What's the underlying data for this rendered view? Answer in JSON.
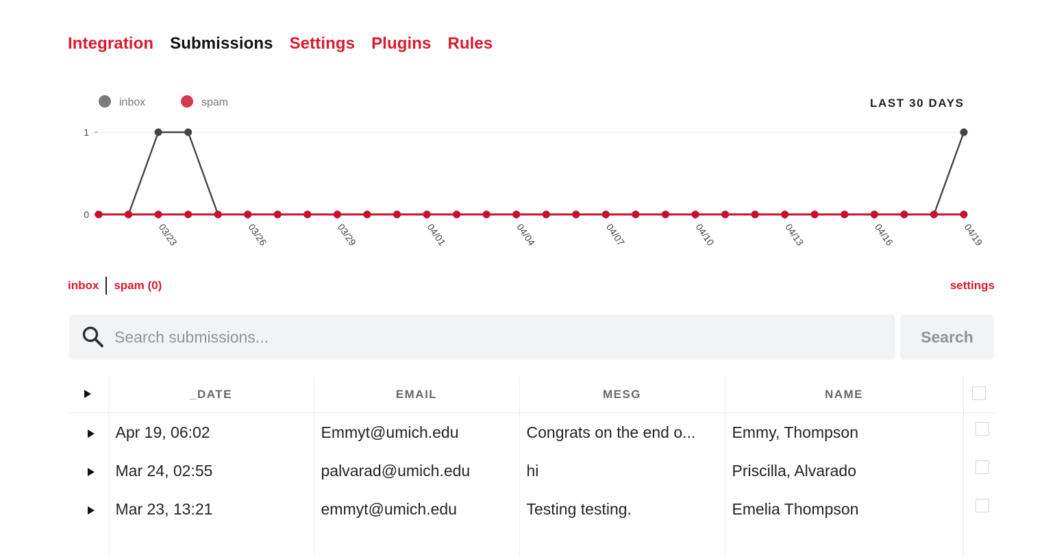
{
  "tabs": [
    {
      "label": "Integration",
      "active": false
    },
    {
      "label": "Submissions",
      "active": true
    },
    {
      "label": "Settings",
      "active": false
    },
    {
      "label": "Plugins",
      "active": false
    },
    {
      "label": "Rules",
      "active": false
    }
  ],
  "range_label": "LAST 30 DAYS",
  "colors": {
    "accent": "#d91a2e",
    "inbox": "#444444",
    "spam": "#c8102e",
    "spam_legend": "#d43a4f",
    "inbox_legend": "#7a7a7a"
  },
  "chart_data": {
    "type": "line",
    "legend": [
      "inbox",
      "spam"
    ],
    "legend_position": "top-left",
    "x": [
      "03/21",
      "03/22",
      "03/23",
      "03/24",
      "03/25",
      "03/26",
      "03/27",
      "03/28",
      "03/29",
      "03/30",
      "03/31",
      "04/01",
      "04/02",
      "04/03",
      "04/04",
      "04/05",
      "04/06",
      "04/07",
      "04/08",
      "04/09",
      "04/10",
      "04/11",
      "04/12",
      "04/13",
      "04/14",
      "04/15",
      "04/16",
      "04/17",
      "04/18",
      "04/19"
    ],
    "tick_labels": [
      "03/23",
      "03/26",
      "03/29",
      "04/01",
      "04/04",
      "04/07",
      "04/10",
      "04/13",
      "04/16",
      "04/19"
    ],
    "y_ticks": [
      "0",
      "1"
    ],
    "ylim": [
      0,
      1
    ],
    "grid": true,
    "series": [
      {
        "name": "inbox",
        "values": [
          0,
          0,
          1,
          1,
          0,
          0,
          0,
          0,
          0,
          0,
          0,
          0,
          0,
          0,
          0,
          0,
          0,
          0,
          0,
          0,
          0,
          0,
          0,
          0,
          0,
          0,
          0,
          0,
          0,
          1
        ]
      },
      {
        "name": "spam",
        "values": [
          0,
          0,
          0,
          0,
          0,
          0,
          0,
          0,
          0,
          0,
          0,
          0,
          0,
          0,
          0,
          0,
          0,
          0,
          0,
          0,
          0,
          0,
          0,
          0,
          0,
          0,
          0,
          0,
          0,
          0
        ]
      }
    ]
  },
  "subnav": {
    "inbox": "inbox",
    "spam": "spam (0)",
    "settings": "settings"
  },
  "search": {
    "placeholder": "Search submissions...",
    "value": "",
    "button": "Search"
  },
  "table": {
    "columns": [
      "_DATE",
      "EMAIL",
      "MESG",
      "NAME"
    ],
    "rows": [
      {
        "date": "Apr 19, 06:02",
        "email": "Emmyt@umich.edu",
        "mesg": "Congrats on the end o...",
        "name": "Emmy, Thompson"
      },
      {
        "date": "Mar 24, 02:55",
        "email": "palvarad@umich.edu",
        "mesg": "hi",
        "name": "Priscilla, Alvarado"
      },
      {
        "date": "Mar 23, 13:21",
        "email": "emmyt@umich.edu",
        "mesg": "Testing testing.",
        "name": "Emelia Thompson"
      }
    ]
  }
}
